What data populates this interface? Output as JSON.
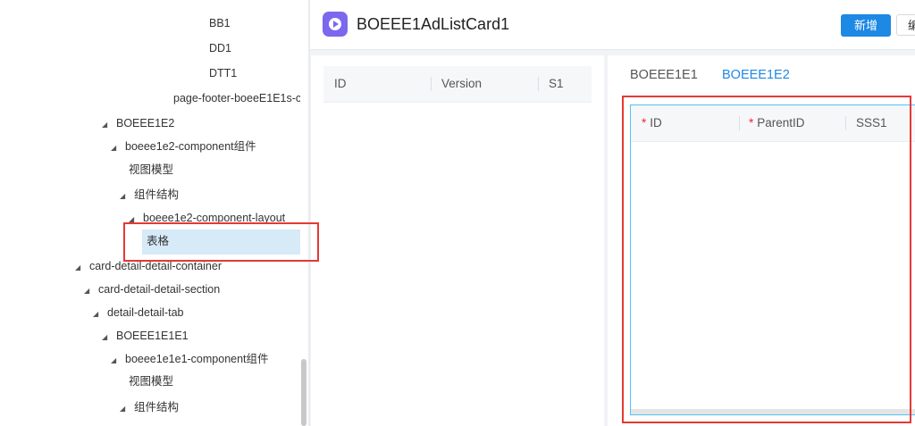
{
  "tree": {
    "items": [
      {
        "label": "BB1",
        "caret": ""
      },
      {
        "label": "DD1",
        "caret": ""
      },
      {
        "label": "DTT1",
        "caret": ""
      },
      {
        "label": "page-footer-boeeE1E1s-c",
        "caret": ""
      },
      {
        "label": "BOEEE1E2",
        "caret": "◢"
      },
      {
        "label": "boeee1e2-component组件",
        "caret": "◢"
      },
      {
        "label": "视图模型",
        "caret": ""
      },
      {
        "label": "组件结构",
        "caret": "◢"
      },
      {
        "label": "boeee1e2-component-layout",
        "caret": "◢"
      },
      {
        "label": "表格",
        "caret": ""
      },
      {
        "label": "card-detail-detail-container",
        "caret": "◢"
      },
      {
        "label": "card-detail-detail-section",
        "caret": "◢"
      },
      {
        "label": "detail-detail-tab",
        "caret": "◢"
      },
      {
        "label": "BOEEE1E1E1",
        "caret": "◢"
      },
      {
        "label": "boeee1e1e1-component组件",
        "caret": "◢"
      },
      {
        "label": "视图模型",
        "caret": ""
      },
      {
        "label": "组件结构",
        "caret": "◢"
      }
    ]
  },
  "header": {
    "title": "BOEEE1AdListCard1",
    "primary_button": "新增",
    "secondary_button": "编"
  },
  "left_grid": {
    "columns": [
      "ID",
      "Version",
      "S1"
    ]
  },
  "right_panel": {
    "tabs": [
      "BOEEE1E1",
      "BOEEE1E2"
    ],
    "active_tab": "BOEEE1E2",
    "columns": [
      {
        "label": "ID",
        "required": "*"
      },
      {
        "label": "ParentID",
        "required": "*"
      },
      {
        "label": "SSS1",
        "required": ""
      }
    ]
  },
  "colors": {
    "accent": "#1e88e5",
    "selection": "#d6eaf8",
    "annotation": "#e53935",
    "app_icon": "#7b68ee"
  }
}
